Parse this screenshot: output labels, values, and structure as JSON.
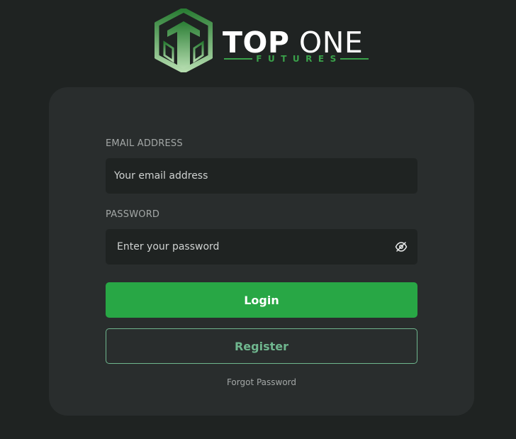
{
  "brand": {
    "title_bold": "TOP",
    "title_light": "ONE",
    "subtitle": "FUTURES",
    "colors": {
      "accent": "#28a745",
      "logo_dark": "#2f7a37",
      "logo_light": "#a8d5a0"
    }
  },
  "form": {
    "email_label": "EMAIL ADDRESS",
    "email_placeholder": "Your email address",
    "email_value": "",
    "password_label": "PASSWORD",
    "password_placeholder": "Enter your password",
    "password_value": "",
    "password_toggle_icon": "eye-off-icon",
    "login_label": "Login",
    "register_label": "Register",
    "forgot_label": "Forgot Password"
  },
  "colors": {
    "background": "#1f2322",
    "card": "#292d2d",
    "input_bg": "#1f2322",
    "login_button": "#28a745",
    "register_border": "#6fb68e"
  }
}
